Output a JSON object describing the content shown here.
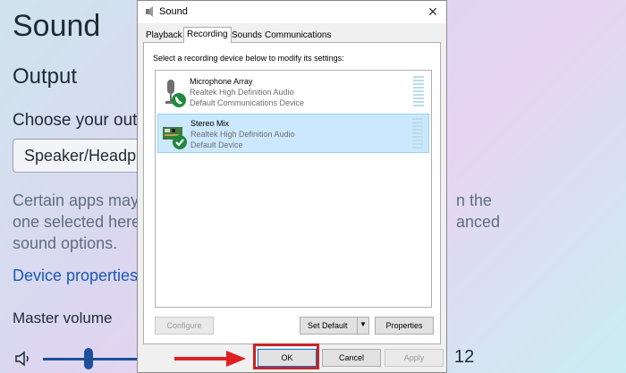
{
  "background": {
    "title": "Sound",
    "output_heading": "Output",
    "choose_label": "Choose your outp",
    "selected_device": "Speaker/Headph",
    "desc_lines": [
      "Certain apps may",
      "one selected here",
      "sound options."
    ],
    "desc_right_lines": [
      "n the",
      "anced"
    ],
    "device_properties_link": "Device properties",
    "master_volume_label": "Master volume",
    "volume_value_partial": "12",
    "volume_level_percent": 12
  },
  "dialog": {
    "title": "Sound",
    "tabs": [
      {
        "label": "Playback",
        "active": false
      },
      {
        "label": "Recording",
        "active": true
      },
      {
        "label": "Sounds",
        "active": false
      },
      {
        "label": "Communications",
        "active": false
      }
    ],
    "instruction": "Select a recording device below to modify its settings:",
    "devices": [
      {
        "name": "Microphone Array",
        "driver": "Realtek High Definition Audio",
        "status": "Default Communications Device",
        "icon": "microphone-icon",
        "badge": "phone-badge-icon",
        "selected": false
      },
      {
        "name": "Stereo Mix",
        "driver": "Realtek High Definition Audio",
        "status": "Default Device",
        "icon": "circuit-board-icon",
        "badge": "checkmark-badge-icon",
        "selected": true
      }
    ],
    "buttons": {
      "configure": "Configure",
      "set_default": "Set Default",
      "properties": "Properties",
      "ok": "OK",
      "cancel": "Cancel",
      "apply": "Apply"
    }
  },
  "colors": {
    "accent_link": "#1a58b5",
    "selection": "#cce8ff",
    "highlight_red": "#cc2222",
    "badge_green": "#1e8a3c"
  }
}
